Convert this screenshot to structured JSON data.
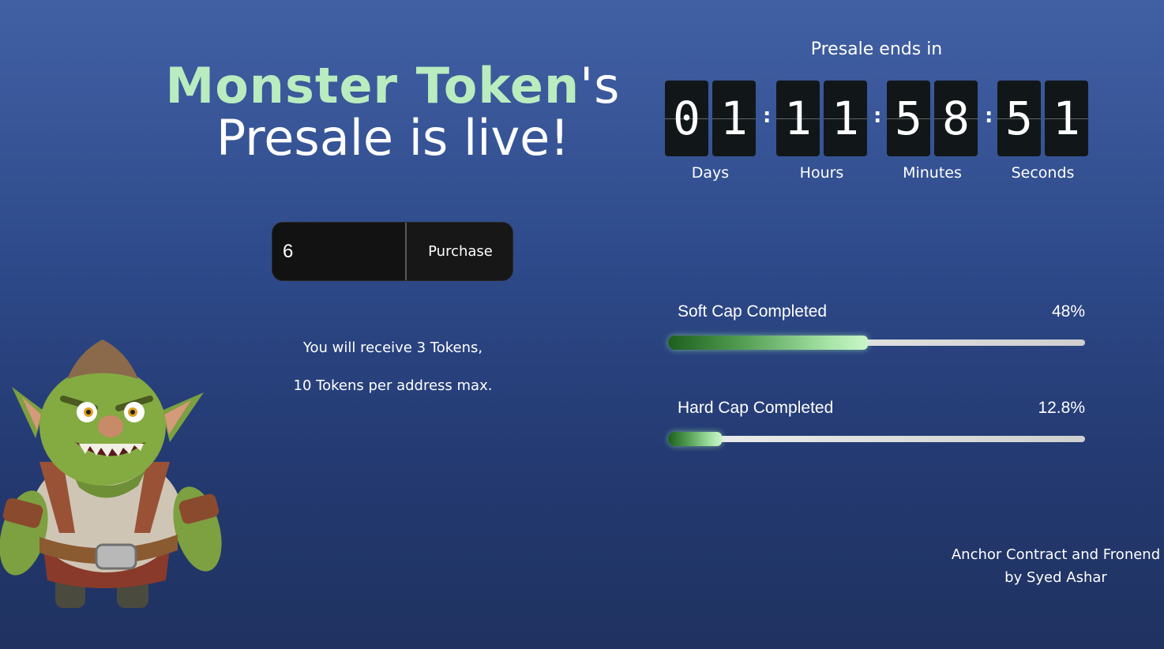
{
  "headline": {
    "brand": "Monster Token",
    "brand_suffix": "'s",
    "line2": "Presale is live!"
  },
  "countdown": {
    "title": "Presale ends in",
    "days": [
      "0",
      "1"
    ],
    "hours": [
      "1",
      "1"
    ],
    "minutes": [
      "5",
      "8"
    ],
    "seconds": [
      "5",
      "1"
    ],
    "separator": ":",
    "labels": {
      "days": "Days",
      "hours": "Hours",
      "minutes": "Minutes",
      "seconds": "Seconds"
    }
  },
  "purchase": {
    "quantity": "6",
    "button_label": "Purchase"
  },
  "info": {
    "receive_text": "You will receive 3 Tokens,",
    "max_text": "10 Tokens per address max."
  },
  "progress": {
    "soft_cap": {
      "label": "Soft Cap Completed",
      "value_text": "48%",
      "fraction": 0.48
    },
    "hard_cap": {
      "label": "Hard Cap Completed",
      "value_text": "12.8%",
      "fraction": 0.128
    }
  },
  "credit": {
    "line1": "Anchor Contract and Fronend",
    "line2": "by Syed Ashar"
  },
  "colors": {
    "accent_green": "#b9ecbf",
    "background_top": "#4160a4",
    "background_bottom": "#1f3260",
    "digit_tile": "#111719"
  }
}
